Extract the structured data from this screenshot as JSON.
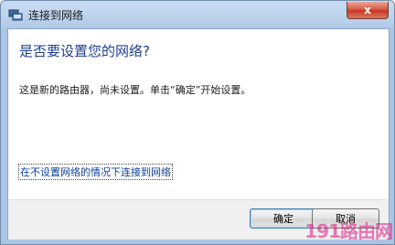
{
  "window": {
    "title": "连接到网络",
    "close_label": "x"
  },
  "dialog": {
    "heading": "是否要设置您的网络?",
    "description": "这是新的路由器，尚未设置。单击“确定”开始设置。",
    "skip_link": "在不设置网络的情况下连接到网络"
  },
  "buttons": {
    "ok": "确定",
    "cancel": "取消"
  },
  "watermark": "191路由网",
  "colors": {
    "accent": "#1f3f8f",
    "link": "#0a3f9c",
    "close": "#c4361f"
  }
}
